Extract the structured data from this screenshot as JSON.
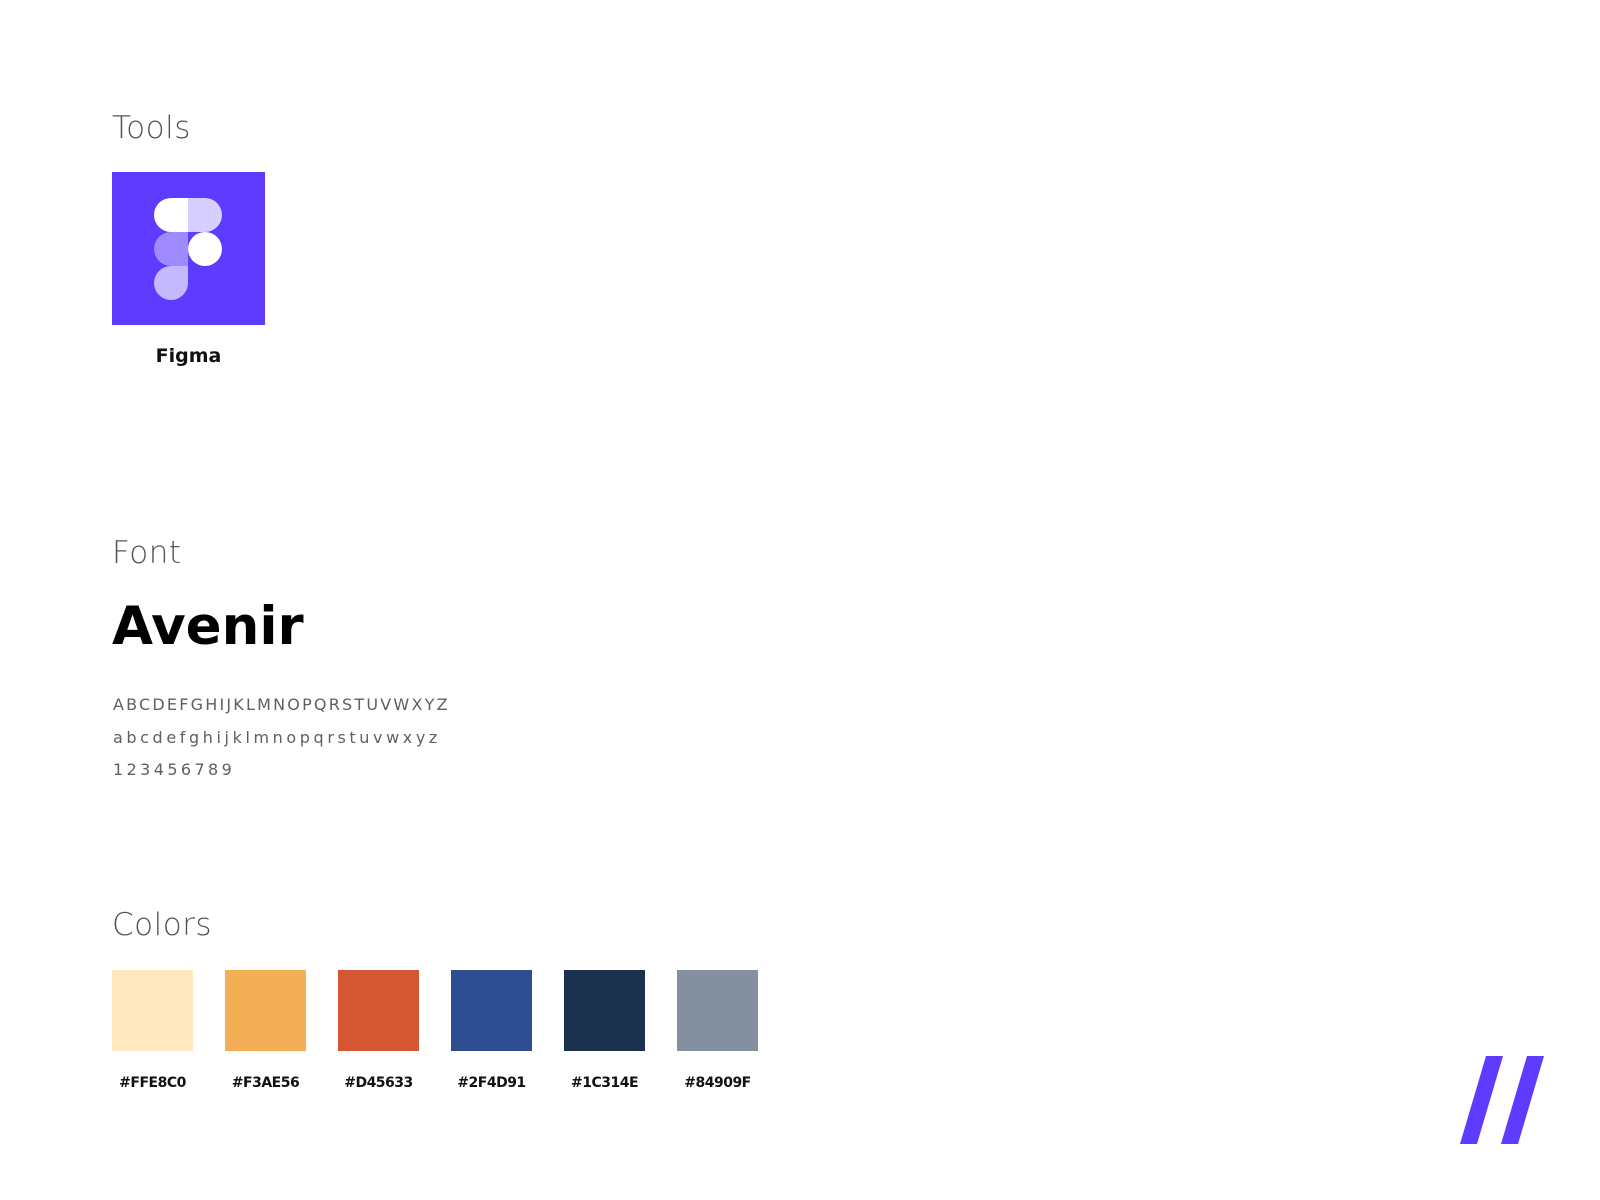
{
  "sections": {
    "tools": "Tools",
    "font": "Font",
    "colors": "Colors"
  },
  "tools": [
    {
      "name": "Figma",
      "icon": "figma-logo-icon",
      "background": "#5E3BFE"
    }
  ],
  "font": {
    "name": "Avenir",
    "uppercase": "ABCDEFGHIJKLMNOPQRSTUVWXYZ",
    "lowercase": "abcdefghijklmnopqrstuvwxyz",
    "digits": "123456789"
  },
  "colors": [
    {
      "hex": "#FFE8C0",
      "label": "#FFE8C0"
    },
    {
      "hex": "#F3AE56",
      "label": "#F3AE56"
    },
    {
      "hex": "#D45633",
      "label": "#D45633"
    },
    {
      "hex": "#2F4D91",
      "label": "#2F4D91"
    },
    {
      "hex": "#1C314E",
      "label": "#1C314E"
    },
    {
      "hex": "#84909F",
      "label": "#84909F"
    }
  ],
  "brand": {
    "icon": "double-slash-logo-icon",
    "color": "#5E3BFE"
  }
}
